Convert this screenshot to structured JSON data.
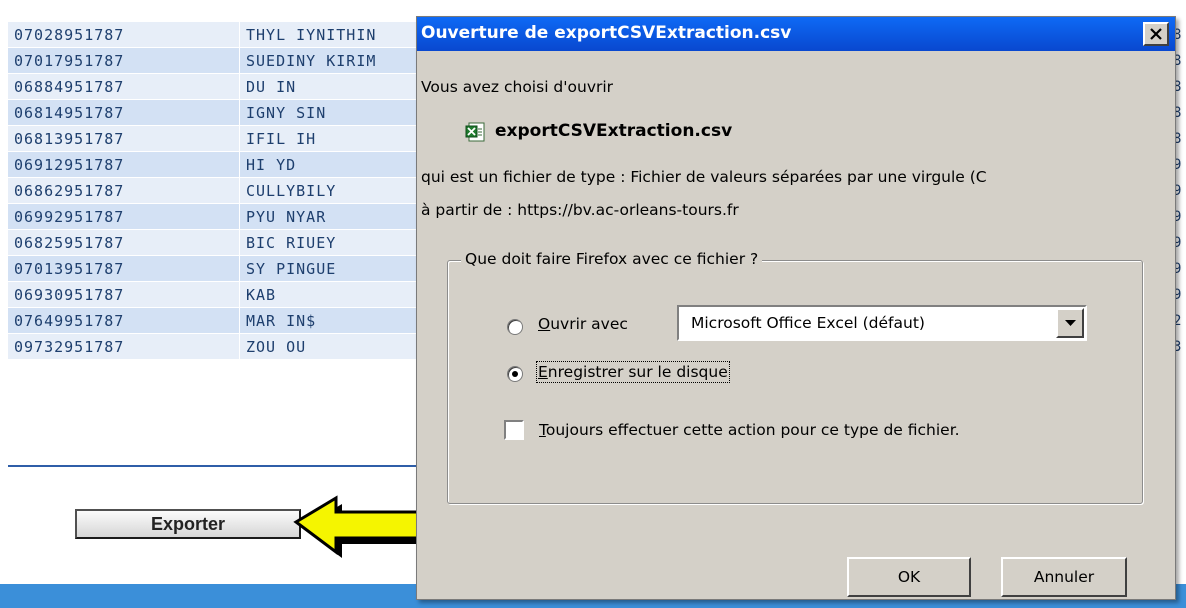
{
  "table": {
    "rows": [
      {
        "id": "07028951787",
        "name": "THYL IYNITHIN"
      },
      {
        "id": "07017951787",
        "name": "SUEDINY KIRIM"
      },
      {
        "id": "06884951787",
        "name": "DU  IN"
      },
      {
        "id": "06814951787",
        "name": "IGNY SIN"
      },
      {
        "id": "06813951787",
        "name": "IFIL IH"
      },
      {
        "id": "06912951787",
        "name": "HI YD"
      },
      {
        "id": "06862951787",
        "name": "CULLYBILY"
      },
      {
        "id": "06992951787",
        "name": "PYU NYAR"
      },
      {
        "id": "06825951787",
        "name": "BIC RIUEY"
      },
      {
        "id": "07013951787",
        "name": "SY  PINGUE"
      },
      {
        "id": "06930951787",
        "name": "KAB"
      },
      {
        "id": "07649951787",
        "name": "MAR IN$"
      },
      {
        "id": "09732951787",
        "name": "ZOU  OU"
      }
    ],
    "right_edge": [
      "8",
      "8",
      "8",
      "8",
      "8",
      "9",
      "9",
      "9",
      "9",
      "9",
      "9",
      "2",
      "3"
    ]
  },
  "export_button": {
    "label": "Exporter"
  },
  "dialog": {
    "title": "Ouverture de exportCSVExtraction.csv",
    "intro": "Vous avez choisi d'ouvrir",
    "file_name": "exportCSVExtraction.csv",
    "file_icon": "excel-csv-file-icon",
    "type_line": "qui est un fichier de type : Fichier de valeurs séparées par une virgule (C",
    "from_line": "à partir de : https://bv.ac-orleans-tours.fr",
    "group_title": "Que doit faire Firefox avec ce fichier ?",
    "open_with": {
      "label_first": "O",
      "label_rest": "uvrir avec",
      "selected": false
    },
    "app_select": {
      "value": "Microsoft Office Excel (défaut)"
    },
    "save": {
      "label_first": "E",
      "label_rest": "nregistrer sur le disque",
      "selected": true
    },
    "always": {
      "label_first": "T",
      "label_rest": "oujours effectuer cette action pour ce type de fichier.",
      "checked": false
    },
    "ok_label": "OK",
    "cancel_label": "Annuler"
  },
  "colors": {
    "titlebar": "#0a58e0",
    "dialog_bg": "#d4d0c8",
    "row_light": "#e7eef8",
    "row_dark": "#d3e1f4",
    "table_text": "#1e3f6e",
    "arrow_fill": "#f5f500",
    "bottom_bar": "#3b8fd9"
  }
}
